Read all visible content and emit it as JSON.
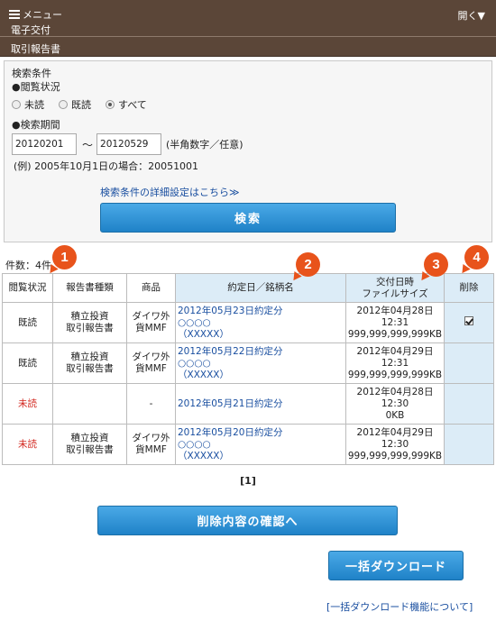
{
  "header": {
    "menu_label": "メニュー",
    "title": "電子交付",
    "open_label": "開く▼",
    "subtitle": "取引報告書"
  },
  "search": {
    "title": "検索条件",
    "read_status_label": "●閲覧状況",
    "read_options": [
      {
        "label": "未読",
        "selected": false
      },
      {
        "label": "既読",
        "selected": false
      },
      {
        "label": "すべて",
        "selected": true
      }
    ],
    "period_label": "●検索期間",
    "from_value": "20120201",
    "tilde": "～",
    "to_value": "20120529",
    "period_note": "(半角数字／任意)",
    "example": "(例) 2005年10月1日の場合：20051001",
    "detail_link": "検索条件の詳細設定はこちら≫",
    "search_button": "検索"
  },
  "results": {
    "count": "件数：4件",
    "headers": {
      "status": "閲覧状況",
      "report_type": "報告書種類",
      "product": "商品",
      "date_name": "約定日／銘柄名",
      "delivery_1": "交付日時",
      "delivery_2": "ファイルサイズ",
      "delete": "削除"
    },
    "rows": [
      {
        "status": "既読",
        "unread": false,
        "type_1": "積立投資",
        "type_2": "取引報告書",
        "product_1": "ダイワ外",
        "product_2": "貨MMF",
        "date": "2012年05月23日約定分",
        "name_1": "○○○○",
        "name_2": "（XXXXX）",
        "del_date": "2012年04月28日",
        "del_time": "12:31",
        "size": "999,999,999,999KB",
        "checked": true
      },
      {
        "status": "既読",
        "unread": false,
        "type_1": "積立投資",
        "type_2": "取引報告書",
        "product_1": "ダイワ外",
        "product_2": "貨MMF",
        "date": "2012年05月22日約定分",
        "name_1": "○○○○",
        "name_2": "（XXXXX）",
        "del_date": "2012年04月29日",
        "del_time": "12:31",
        "size": "999,999,999,999KB",
        "checked": false
      },
      {
        "status": "未読",
        "unread": true,
        "type_1": "",
        "type_2": "",
        "product_1": "-",
        "product_2": "",
        "date": "2012年05月21日約定分",
        "name_1": "",
        "name_2": "",
        "del_date": "2012年04月28日",
        "del_time": "12:30",
        "size": "0KB",
        "checked": false
      },
      {
        "status": "未読",
        "unread": true,
        "type_1": "積立投資",
        "type_2": "取引報告書",
        "product_1": "ダイワ外",
        "product_2": "貨MMF",
        "date": "2012年05月20日約定分",
        "name_1": "○○○○",
        "name_2": "（XXXXX）",
        "del_date": "2012年04月29日",
        "del_time": "12:30",
        "size": "999,999,999,999KB",
        "checked": false
      }
    ]
  },
  "markers": [
    "1",
    "2",
    "3",
    "4"
  ],
  "pagination": "[1]",
  "confirm_button": "削除内容の確認へ",
  "download_button": "一括ダウンロード",
  "download_about_link": "[一括ダウンロード機能について]",
  "colors": {
    "header_bg": "#5b4638",
    "button_blue": "#1f82c8",
    "link_blue": "#1a4fa0",
    "unread_red": "#d1241b",
    "highlight_cell": "#dcecf7",
    "marker_orange": "#e8531b"
  }
}
